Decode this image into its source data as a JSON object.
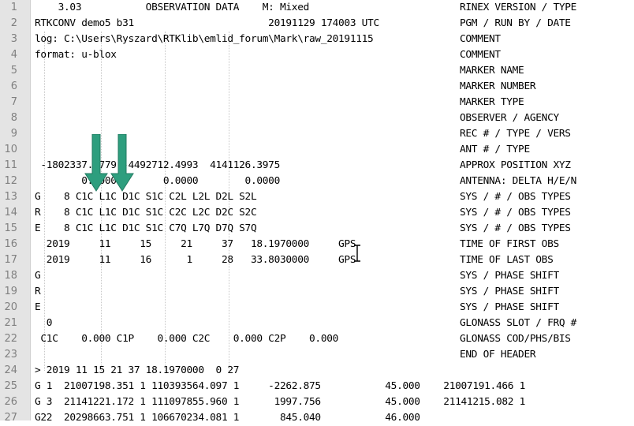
{
  "editor": {
    "lines": [
      {
        "num": "1",
        "text": "    3.03           OBSERVATION DATA    M: Mixed",
        "label": "RINEX VERSION / TYPE"
      },
      {
        "num": "2",
        "text": "RTKCONV demo5 b31                       20191129 174003 UTC",
        "label": "PGM / RUN BY / DATE"
      },
      {
        "num": "3",
        "text": "log: C:\\Users\\Ryszard\\RTKlib\\emlid_forum\\Mark\\raw_20191115",
        "label": "COMMENT"
      },
      {
        "num": "4",
        "text": "format: u-blox",
        "label": "COMMENT"
      },
      {
        "num": "5",
        "text": "",
        "label": "MARKER NAME"
      },
      {
        "num": "6",
        "text": "",
        "label": "MARKER NUMBER"
      },
      {
        "num": "7",
        "text": "",
        "label": "MARKER TYPE"
      },
      {
        "num": "8",
        "text": "",
        "label": "OBSERVER / AGENCY"
      },
      {
        "num": "9",
        "text": "",
        "label": "REC # / TYPE / VERS"
      },
      {
        "num": "10",
        "text": "",
        "label": "ANT # / TYPE"
      },
      {
        "num": "11",
        "text": " -1802337.7779 -4492712.4993  4141126.3975",
        "label": "APPROX POSITION XYZ"
      },
      {
        "num": "12",
        "text": "        0.0000        0.0000        0.0000",
        "label": "ANTENNA: DELTA H/E/N"
      },
      {
        "num": "13",
        "text": "G    8 C1C L1C D1C S1C C2L L2L D2L S2L",
        "label": "SYS / # / OBS TYPES"
      },
      {
        "num": "14",
        "text": "R    8 C1C L1C D1C S1C C2C L2C D2C S2C",
        "label": "SYS / # / OBS TYPES"
      },
      {
        "num": "15",
        "text": "E    8 C1C L1C D1C S1C C7Q L7Q D7Q S7Q",
        "label": "SYS / # / OBS TYPES"
      },
      {
        "num": "16",
        "text": "  2019     11     15     21     37   18.1970000     GPS",
        "label": "TIME OF FIRST OBS"
      },
      {
        "num": "17",
        "text": "  2019     11     16      1     28   33.8030000     GPS",
        "label": "TIME OF LAST OBS"
      },
      {
        "num": "18",
        "text": "G",
        "label": "SYS / PHASE SHIFT"
      },
      {
        "num": "19",
        "text": "R",
        "label": "SYS / PHASE SHIFT"
      },
      {
        "num": "20",
        "text": "E",
        "label": "SYS / PHASE SHIFT"
      },
      {
        "num": "21",
        "text": "  0",
        "label": "GLONASS SLOT / FRQ #"
      },
      {
        "num": "22",
        "text": " C1C    0.000 C1P    0.000 C2C    0.000 C2P    0.000",
        "label": "GLONASS COD/PHS/BIS"
      },
      {
        "num": "23",
        "text": "",
        "label": "END OF HEADER"
      },
      {
        "num": "24",
        "text": "> 2019 11 15 21 37 18.1970000  0 27",
        "label": ""
      },
      {
        "num": "25",
        "text": "G 1  21007198.351 1 110393564.097 1     -2262.875           45.000    21007191.466 1",
        "label": ""
      },
      {
        "num": "26",
        "text": "G 3  21141221.172 1 111097855.960 1      1997.756           45.000    21141215.082 1",
        "label": ""
      },
      {
        "num": "27",
        "text": "G22  20298663.751 1 106670234.081 1       845.040           46.000",
        "label": ""
      }
    ]
  },
  "colors": {
    "arrow": "#2e9e7e",
    "arrow_edge": "#217a60"
  },
  "icons": {
    "arrows": "down-arrow-icon",
    "cursor": "text-cursor-icon"
  }
}
